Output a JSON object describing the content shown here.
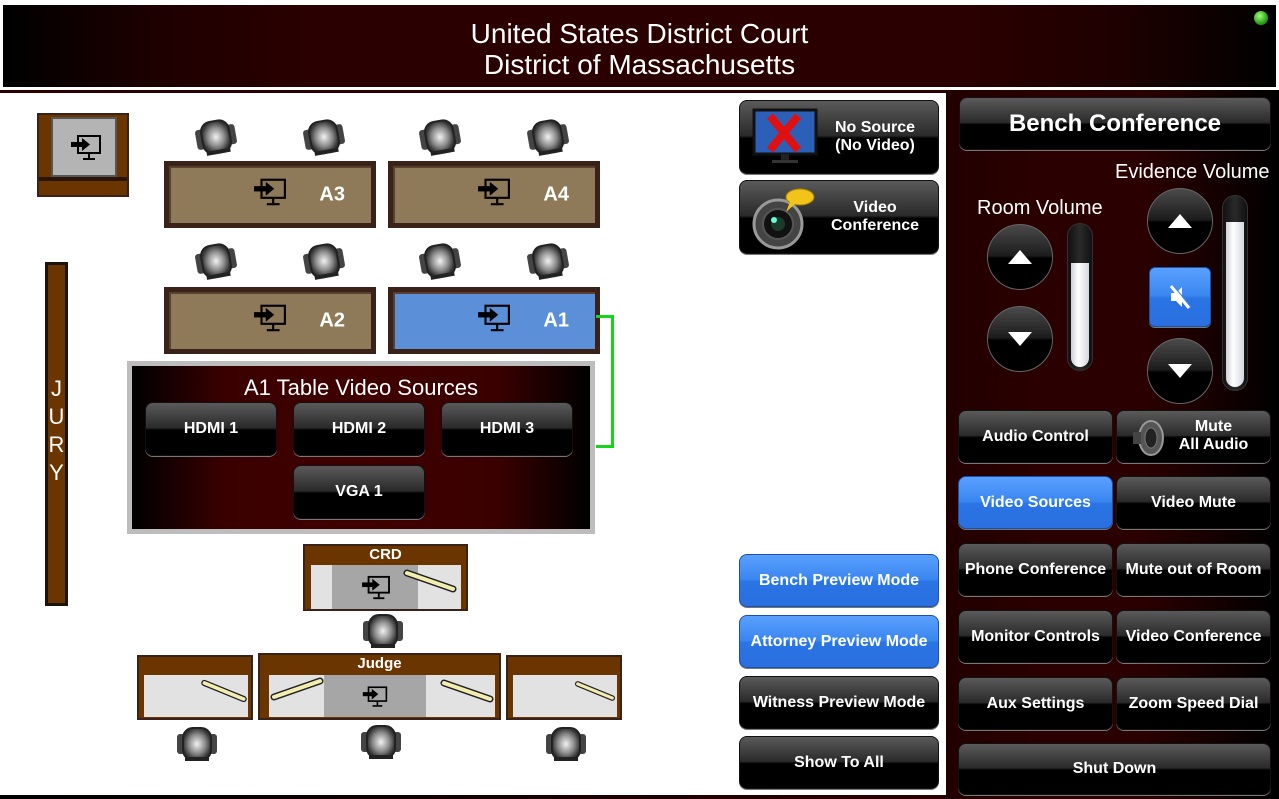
{
  "header": {
    "title_line1": "United States District Court",
    "title_line2": "District of Massachusetts",
    "status_indicator_color": "#2ea11a"
  },
  "courtroom": {
    "jury_letters": [
      "J",
      "U",
      "R",
      "Y"
    ],
    "tables": [
      {
        "id": "A3",
        "label": "A3",
        "selected": false
      },
      {
        "id": "A4",
        "label": "A4",
        "selected": false
      },
      {
        "id": "A2",
        "label": "A2",
        "selected": false
      },
      {
        "id": "A1",
        "label": "A1",
        "selected": true
      }
    ],
    "crd_label": "CRD",
    "judge_label": "Judge"
  },
  "source_popup": {
    "title": "A1 Table Video Sources",
    "sources": [
      "HDMI 1",
      "HDMI 2",
      "HDMI 3",
      "VGA 1"
    ]
  },
  "sources": {
    "no_source_line1": "No Source",
    "no_source_line2": "(No Video)",
    "video_conf_line1": "Video",
    "video_conf_line2": "Conference"
  },
  "preview_modes": [
    {
      "label": "Bench Preview Mode",
      "active": true
    },
    {
      "label": "Attorney Preview Mode",
      "active": true
    },
    {
      "label": "Witness Preview Mode",
      "active": false
    },
    {
      "label": "Show To All",
      "active": false
    }
  ],
  "right_panel": {
    "title_button": "Bench Conference",
    "room_volume": {
      "label": "Room Volume",
      "level_percent": 74
    },
    "evidence_volume": {
      "label": "Evidence Volume",
      "level_percent": 88,
      "muted": true
    },
    "buttons": {
      "audio_control": "Audio Control",
      "mute_all_line1": "Mute",
      "mute_all_line2": "All Audio",
      "video_sources": "Video Sources",
      "video_mute": "Video Mute",
      "phone_conference": "Phone Conference",
      "mute_out_of_room": "Mute out of Room",
      "monitor_controls": "Monitor Controls",
      "video_conference": "Video Conference",
      "aux_settings": "Aux Settings",
      "zoom_speed_dial": "Zoom Speed Dial",
      "shut_down": "Shut Down"
    },
    "accent_color": "#3a86f0"
  }
}
